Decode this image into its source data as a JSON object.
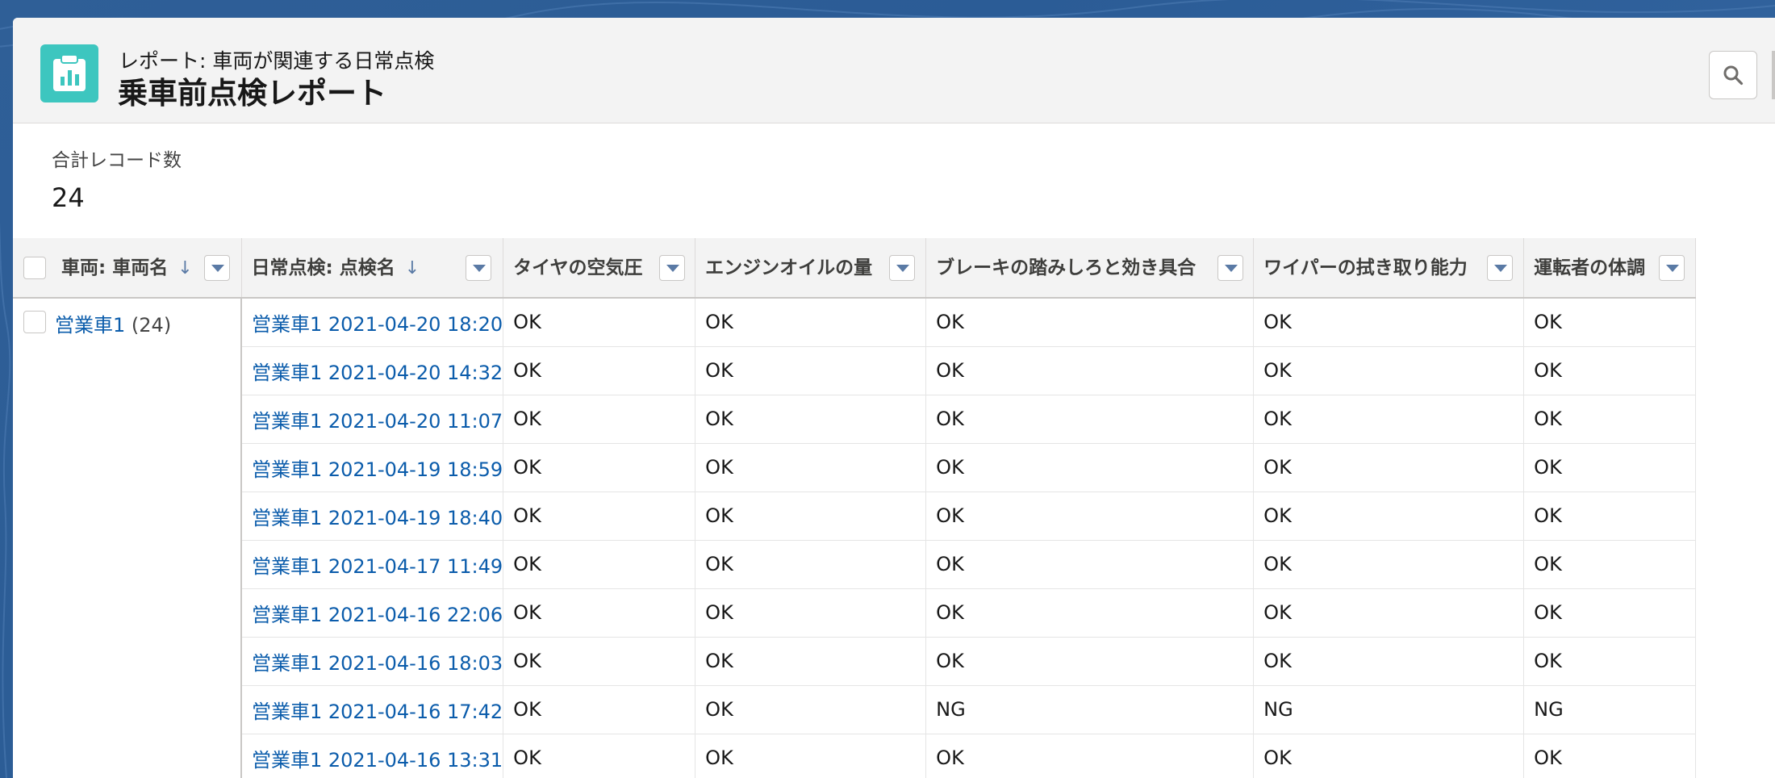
{
  "header": {
    "subtitle": "レポート: 車両が関連する日常点検",
    "title": "乗車前点検レポート",
    "icon": "report-clipboard-icon",
    "icon_color": "#3dc6bf"
  },
  "summary": {
    "label": "合計レコード数",
    "value": "24"
  },
  "table": {
    "columns": [
      {
        "label": "車両: 車両名",
        "sort": "↓"
      },
      {
        "label": "日常点検: 点検名",
        "sort": "↓"
      },
      {
        "label": "タイヤの空気圧"
      },
      {
        "label": "エンジンオイルの量"
      },
      {
        "label": "ブレーキの踏みしろと効き具合"
      },
      {
        "label": "ワイパーの拭き取り能力"
      },
      {
        "label": "運転者の体調"
      }
    ],
    "group": {
      "name": "営業車1",
      "count": "(24)"
    },
    "rows": [
      [
        "営業車1 2021-04-20 18:20",
        "OK",
        "OK",
        "OK",
        "OK",
        "OK"
      ],
      [
        "営業車1 2021-04-20 14:32",
        "OK",
        "OK",
        "OK",
        "OK",
        "OK"
      ],
      [
        "営業車1 2021-04-20 11:07",
        "OK",
        "OK",
        "OK",
        "OK",
        "OK"
      ],
      [
        "営業車1 2021-04-19 18:59",
        "OK",
        "OK",
        "OK",
        "OK",
        "OK"
      ],
      [
        "営業車1 2021-04-19 18:40",
        "OK",
        "OK",
        "OK",
        "OK",
        "OK"
      ],
      [
        "営業車1 2021-04-17 11:49",
        "OK",
        "OK",
        "OK",
        "OK",
        "OK"
      ],
      [
        "営業車1 2021-04-16 22:06",
        "OK",
        "OK",
        "OK",
        "OK",
        "OK"
      ],
      [
        "営業車1 2021-04-16 18:03",
        "OK",
        "OK",
        "OK",
        "OK",
        "OK"
      ],
      [
        "営業車1 2021-04-16 17:42",
        "OK",
        "OK",
        "NG",
        "NG",
        "NG"
      ],
      [
        "営業車1 2021-04-16 13:31",
        "OK",
        "OK",
        "OK",
        "OK",
        "OK"
      ]
    ]
  },
  "colors": {
    "link": "#0b5cab",
    "background": "#2f5f97"
  }
}
